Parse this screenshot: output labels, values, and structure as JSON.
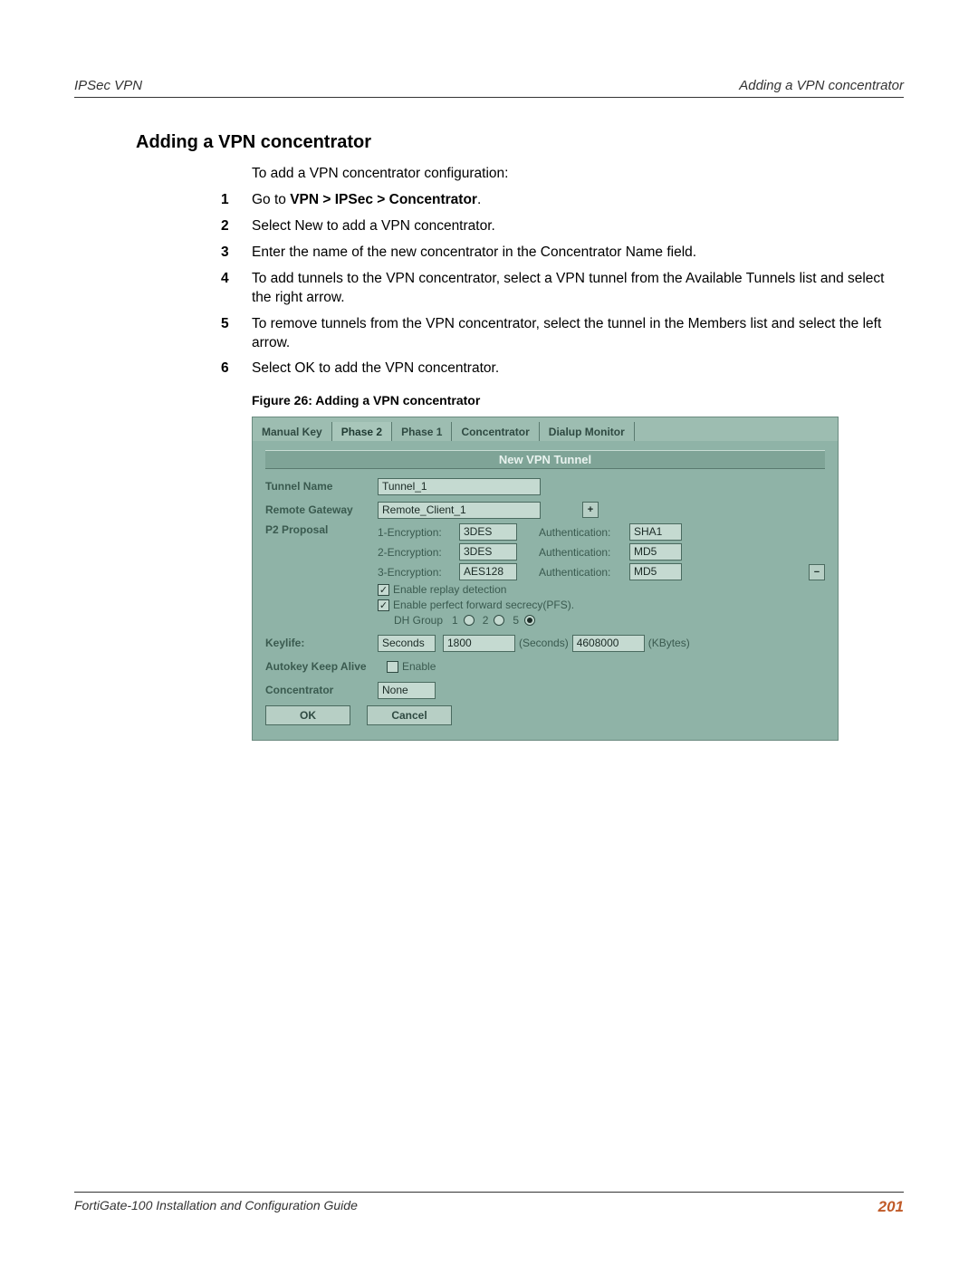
{
  "header": {
    "left": "IPSec VPN",
    "right": "Adding a VPN concentrator"
  },
  "section_title": "Adding a VPN concentrator",
  "intro": "To add a VPN concentrator configuration:",
  "steps": [
    {
      "n": "1",
      "prefix": "Go to ",
      "bold": "VPN > IPSec > Concentrator",
      "suffix": "."
    },
    {
      "n": "2",
      "text": "Select New to add a VPN concentrator."
    },
    {
      "n": "3",
      "text": "Enter the name of the new concentrator in the Concentrator Name field."
    },
    {
      "n": "4",
      "text": "To add tunnels to the VPN concentrator, select a VPN tunnel from the Available Tunnels list and select the right arrow."
    },
    {
      "n": "5",
      "text": "To remove tunnels from the VPN concentrator, select the tunnel in the Members list and select the left arrow."
    },
    {
      "n": "6",
      "text": "Select OK to add the VPN concentrator."
    }
  ],
  "figure_caption": "Figure 26: Adding a VPN concentrator",
  "screenshot": {
    "tabs": [
      "Manual Key",
      "Phase 2",
      "Phase 1",
      "Concentrator",
      "Dialup Monitor"
    ],
    "active_tab_index": 1,
    "panel_title": "New VPN Tunnel",
    "fields": {
      "tunnel_name_label": "Tunnel Name",
      "tunnel_name_value": "Tunnel_1",
      "remote_gateway_label": "Remote Gateway",
      "remote_gateway_value": "Remote_Client_1",
      "p2_label": "P2 Proposal",
      "p2": [
        {
          "enc_label": "1-Encryption:",
          "enc": "3DES",
          "auth_label": "Authentication:",
          "auth": "SHA1"
        },
        {
          "enc_label": "2-Encryption:",
          "enc": "3DES",
          "auth_label": "Authentication:",
          "auth": "MD5"
        },
        {
          "enc_label": "3-Encryption:",
          "enc": "AES128",
          "auth_label": "Authentication:",
          "auth": "MD5"
        }
      ],
      "replay_label": "Enable replay detection",
      "pfs_label": "Enable perfect forward secrecy(PFS).",
      "dh_label": "DH Group",
      "dh_options": [
        "1",
        "2",
        "5"
      ],
      "dh_selected": "5",
      "keylife_label": "Keylife:",
      "keylife_unit": "Seconds",
      "keylife_seconds": "1800",
      "keylife_seconds_suffix": "(Seconds)",
      "keylife_kbytes": "4608000",
      "keylife_kbytes_suffix": "(KBytes)",
      "autokey_label": "Autokey Keep Alive",
      "autokey_value": "Enable",
      "concentrator_label": "Concentrator",
      "concentrator_value": "None",
      "ok": "OK",
      "cancel": "Cancel",
      "plus": "+",
      "minus": "−"
    }
  },
  "footer": {
    "left": "FortiGate-100 Installation and Configuration Guide",
    "page": "201"
  }
}
